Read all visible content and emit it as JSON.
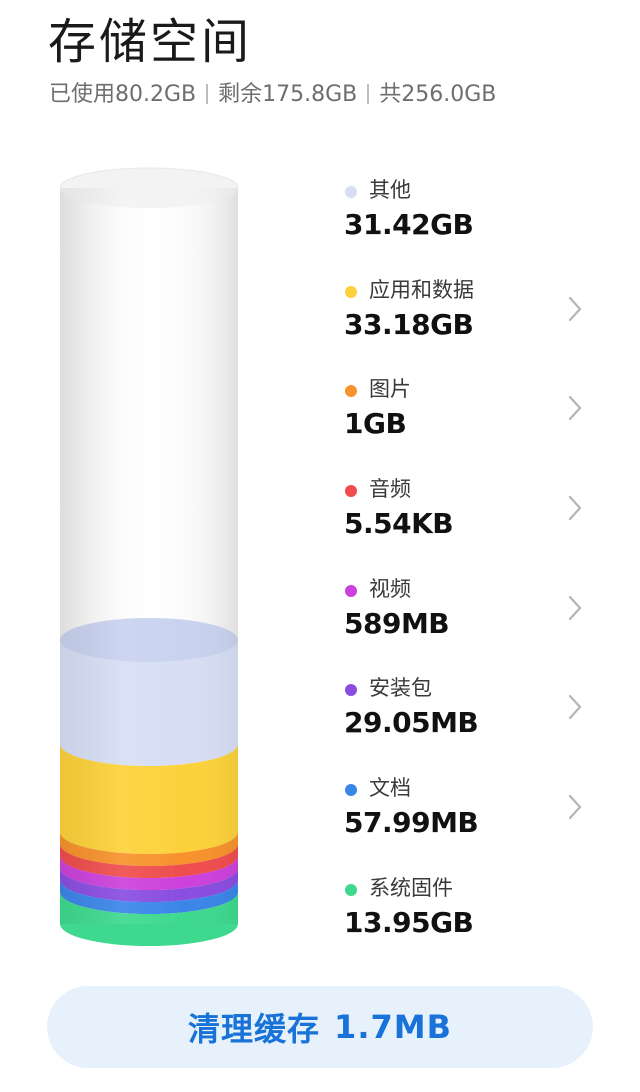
{
  "header": {
    "title": "存储空间",
    "used": "已使用80.2GB",
    "free": "剩余175.8GB",
    "total": "共256.0GB"
  },
  "storage": {
    "categories": [
      {
        "label": "其他",
        "value": "31.42GB",
        "color": "#d7def4",
        "has_chevron": false
      },
      {
        "label": "应用和数据",
        "value": "33.18GB",
        "color": "#fcd23a",
        "has_chevron": true
      },
      {
        "label": "图片",
        "value": "1GB",
        "color": "#f7922c",
        "has_chevron": true
      },
      {
        "label": "音频",
        "value": "5.54KB",
        "color": "#ef4d4d",
        "has_chevron": true
      },
      {
        "label": "视频",
        "value": "589MB",
        "color": "#cc41db",
        "has_chevron": true
      },
      {
        "label": "安装包",
        "value": "29.05MB",
        "color": "#8a4de0",
        "has_chevron": true
      },
      {
        "label": "文档",
        "value": "57.99MB",
        "color": "#3a86e8",
        "has_chevron": true
      },
      {
        "label": "系统固件",
        "value": "13.95GB",
        "color": "#3ed98e",
        "has_chevron": false
      }
    ],
    "capacity_color": "#f7f7f7"
  },
  "clean_button": {
    "label": "清理缓存",
    "size": "1.7MB",
    "text_color": "#1872d8",
    "bg_color": "#e6f1fc"
  }
}
